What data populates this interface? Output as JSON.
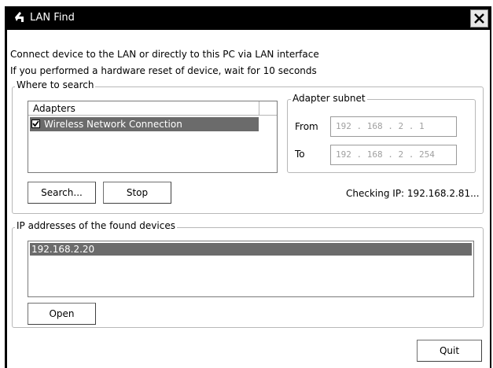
{
  "window": {
    "title": "LAN Find"
  },
  "info": {
    "line1": "Connect device to the LAN or directly to this PC via LAN interface",
    "line2": "If you performed a hardware reset of device, wait for 10 seconds"
  },
  "search_group": {
    "legend": "Where to search",
    "adapters_header": "Adapters",
    "adapters": [
      {
        "name": "Wireless Network Connection",
        "checked": true
      }
    ],
    "subnet_legend": "Adapter subnet",
    "from_label": "From",
    "from_value": "192 . 168 .  2  .  1",
    "to_label": "To",
    "to_value": "192 . 168 .  2  . 254",
    "search_button": "Search...",
    "stop_button": "Stop",
    "status": "Checking IP: 192.168.2.81..."
  },
  "found_group": {
    "legend": "IP addresses of the found devices",
    "items": [
      "192.168.2.20"
    ],
    "open_button": "Open"
  },
  "quit_button": "Quit"
}
